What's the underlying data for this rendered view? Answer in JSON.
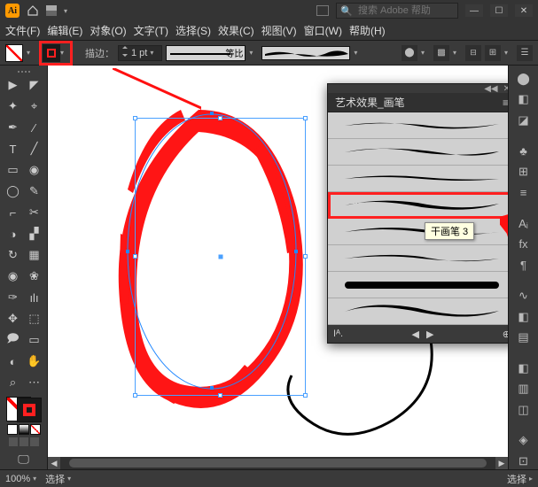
{
  "titlebar": {
    "searchPlaceholder": "搜索 Adobe 帮助",
    "arrangeIcon": "arrange"
  },
  "menu": {
    "items": [
      "文件(F)",
      "编辑(E)",
      "对象(O)",
      "文字(T)",
      "选择(S)",
      "效果(C)",
      "视图(V)",
      "窗口(W)",
      "帮助(H)"
    ]
  },
  "options": {
    "strokeLabel": "描边：",
    "strokeWeight": "1 pt",
    "profileLabel": "等比",
    "opacityIcon": "●"
  },
  "brushPanel": {
    "title": "艺术效果_画笔",
    "rows": 8,
    "selectedIndex": 3,
    "tooltip": "干画笔 3",
    "footer": {
      "lib": "Iᴬ.",
      "prev": "◀",
      "next": "▶"
    }
  },
  "status": {
    "zoom": "100%",
    "toolL": "选择",
    "toolR": "选择"
  },
  "tools": {
    "rows": [
      [
        "▶",
        "◤"
      ],
      [
        "✦",
        "⌖"
      ],
      [
        "✒",
        "⁄"
      ],
      [
        "T",
        "╱"
      ],
      [
        "▭",
        "◉"
      ],
      [
        "◯",
        "✎"
      ],
      [
        "⌐",
        "✂"
      ],
      [
        "◑",
        "▞"
      ],
      [
        "↻",
        "▦"
      ],
      [
        "◉",
        "❀"
      ],
      [
        "✑",
        "ılı"
      ],
      [
        "✥",
        "⬚"
      ],
      [
        "🗩",
        "▭"
      ],
      [
        "◐",
        "✋"
      ],
      [
        "⌕",
        "⋯"
      ]
    ]
  },
  "dock": {
    "icons": [
      "⬤",
      "◧",
      "◪",
      "♣",
      "⊞",
      "≡",
      "Aᵢ",
      "fx",
      "¶",
      "∿",
      "◧",
      "▤",
      "◧",
      "▥",
      "◫",
      "◈",
      "⊡"
    ]
  }
}
